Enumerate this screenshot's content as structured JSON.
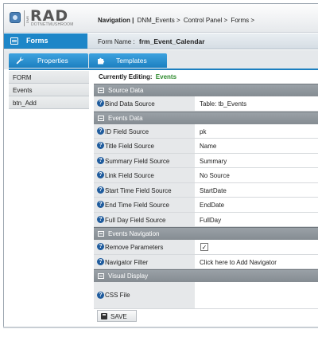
{
  "logo": {
    "main": "RAD",
    "sub": "DOTNETMUSHROOM",
    "side": "DMR"
  },
  "breadcrumb": {
    "label": "Navigation |",
    "items": [
      "DNM_Events >",
      "Control Panel >",
      "Forms >"
    ]
  },
  "title_bar": {
    "module_label": "Forms",
    "form_name_label": "Form Name :",
    "form_name_value": "frm_Event_Calendar"
  },
  "tabs": [
    {
      "label": "Properties",
      "icon": "wrench-icon"
    },
    {
      "label": "Templates",
      "icon": "puzzle-icon"
    }
  ],
  "sidebar": {
    "items": [
      {
        "label": "FORM"
      },
      {
        "label": "Events"
      },
      {
        "label": "btn_Add"
      }
    ]
  },
  "editing": {
    "label": "Currently Editing:",
    "value": "Events"
  },
  "sections": {
    "source_data": {
      "title": "Source Data",
      "rows": [
        {
          "label": "Bind Data Source",
          "value": "Table: tb_Events"
        }
      ]
    },
    "events_data": {
      "title": "Events Data",
      "rows": [
        {
          "label": "ID Field Source",
          "value": "pk"
        },
        {
          "label": "Title Field Source",
          "value": "Name"
        },
        {
          "label": "Summary Field Source",
          "value": "Summary"
        },
        {
          "label": "Link Field Source",
          "value": "No Source"
        },
        {
          "label": "Start Time Field Source",
          "value": "StartDate"
        },
        {
          "label": "End Time Field Source",
          "value": "EndDate"
        },
        {
          "label": "Full Day Field Source",
          "value": "FullDay"
        }
      ]
    },
    "events_navigation": {
      "title": "Events Navigation",
      "remove_parameters": {
        "label": "Remove Parameters",
        "checked": true,
        "check_glyph": "✓"
      },
      "navigator_filter": {
        "label": "Navigator Filter",
        "value": "Click here to Add Navigator"
      }
    },
    "visual_display": {
      "title": "Visual Display",
      "css_file": {
        "label": "CSS File",
        "value": ""
      }
    }
  },
  "help_glyph": "?",
  "save": {
    "label": "SAVE"
  },
  "colors": {
    "accent": "#1d86c8",
    "section_header": "#8e959b",
    "editing_value": "#2d8a2d",
    "help_icon": "#1f5c9e"
  }
}
